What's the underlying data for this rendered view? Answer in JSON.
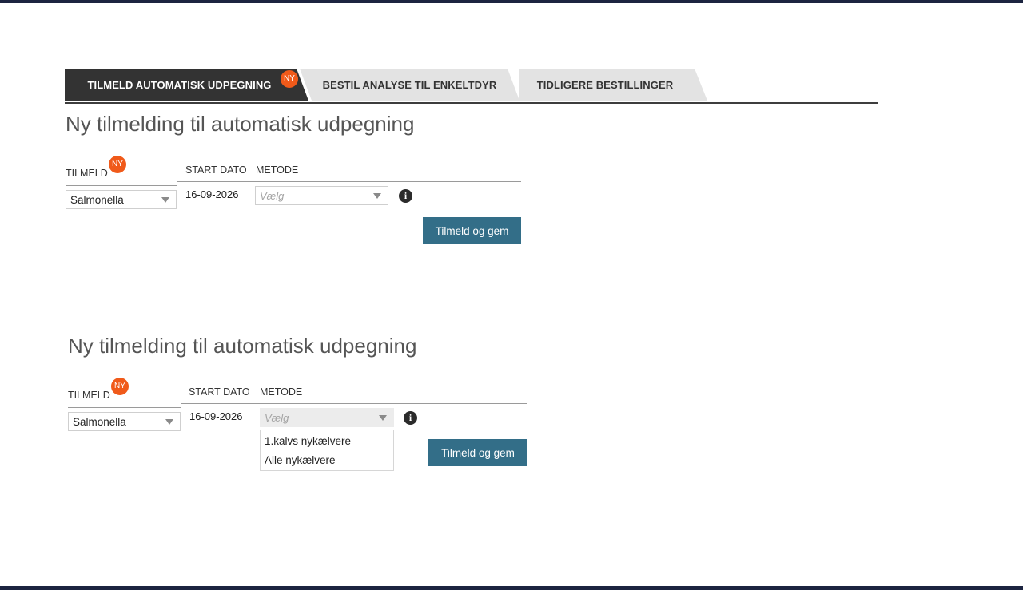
{
  "tabs": [
    {
      "label": "TILMELD AUTOMATISK UDPEGNING",
      "badge": "NY",
      "active": true
    },
    {
      "label": "BESTIL ANALYSE TIL ENKELTDYR",
      "active": false
    },
    {
      "label": "TIDLIGERE BESTILLINGER",
      "active": false
    }
  ],
  "form1": {
    "title": "Ny tilmelding til automatisk udpegning",
    "tilmeld_label": "TILMELD",
    "badge": "NY",
    "start_dato_label": "START DATO",
    "metode_label": "METODE",
    "tilmeld_value": "Salmonella",
    "start_dato_value": "16-09-2026",
    "metode_placeholder": "Vælg",
    "submit_label": "Tilmeld og gem"
  },
  "form2": {
    "title": "Ny tilmelding til automatisk udpegning",
    "tilmeld_label": "TILMELD",
    "badge": "NY",
    "start_dato_label": "START DATO",
    "metode_label": "METODE",
    "tilmeld_value": "Salmonella",
    "start_dato_value": "16-09-2026",
    "metode_placeholder": "Vælg",
    "metode_options": [
      "1.kalvs nykælvere",
      "Alle nykælvere"
    ],
    "submit_label": "Tilmeld og gem"
  },
  "colors": {
    "header_bar": "#1c2440",
    "active_tab": "#333333",
    "inactive_tab": "#e3e3e3",
    "badge": "#f05a1a",
    "button": "#336e88"
  }
}
